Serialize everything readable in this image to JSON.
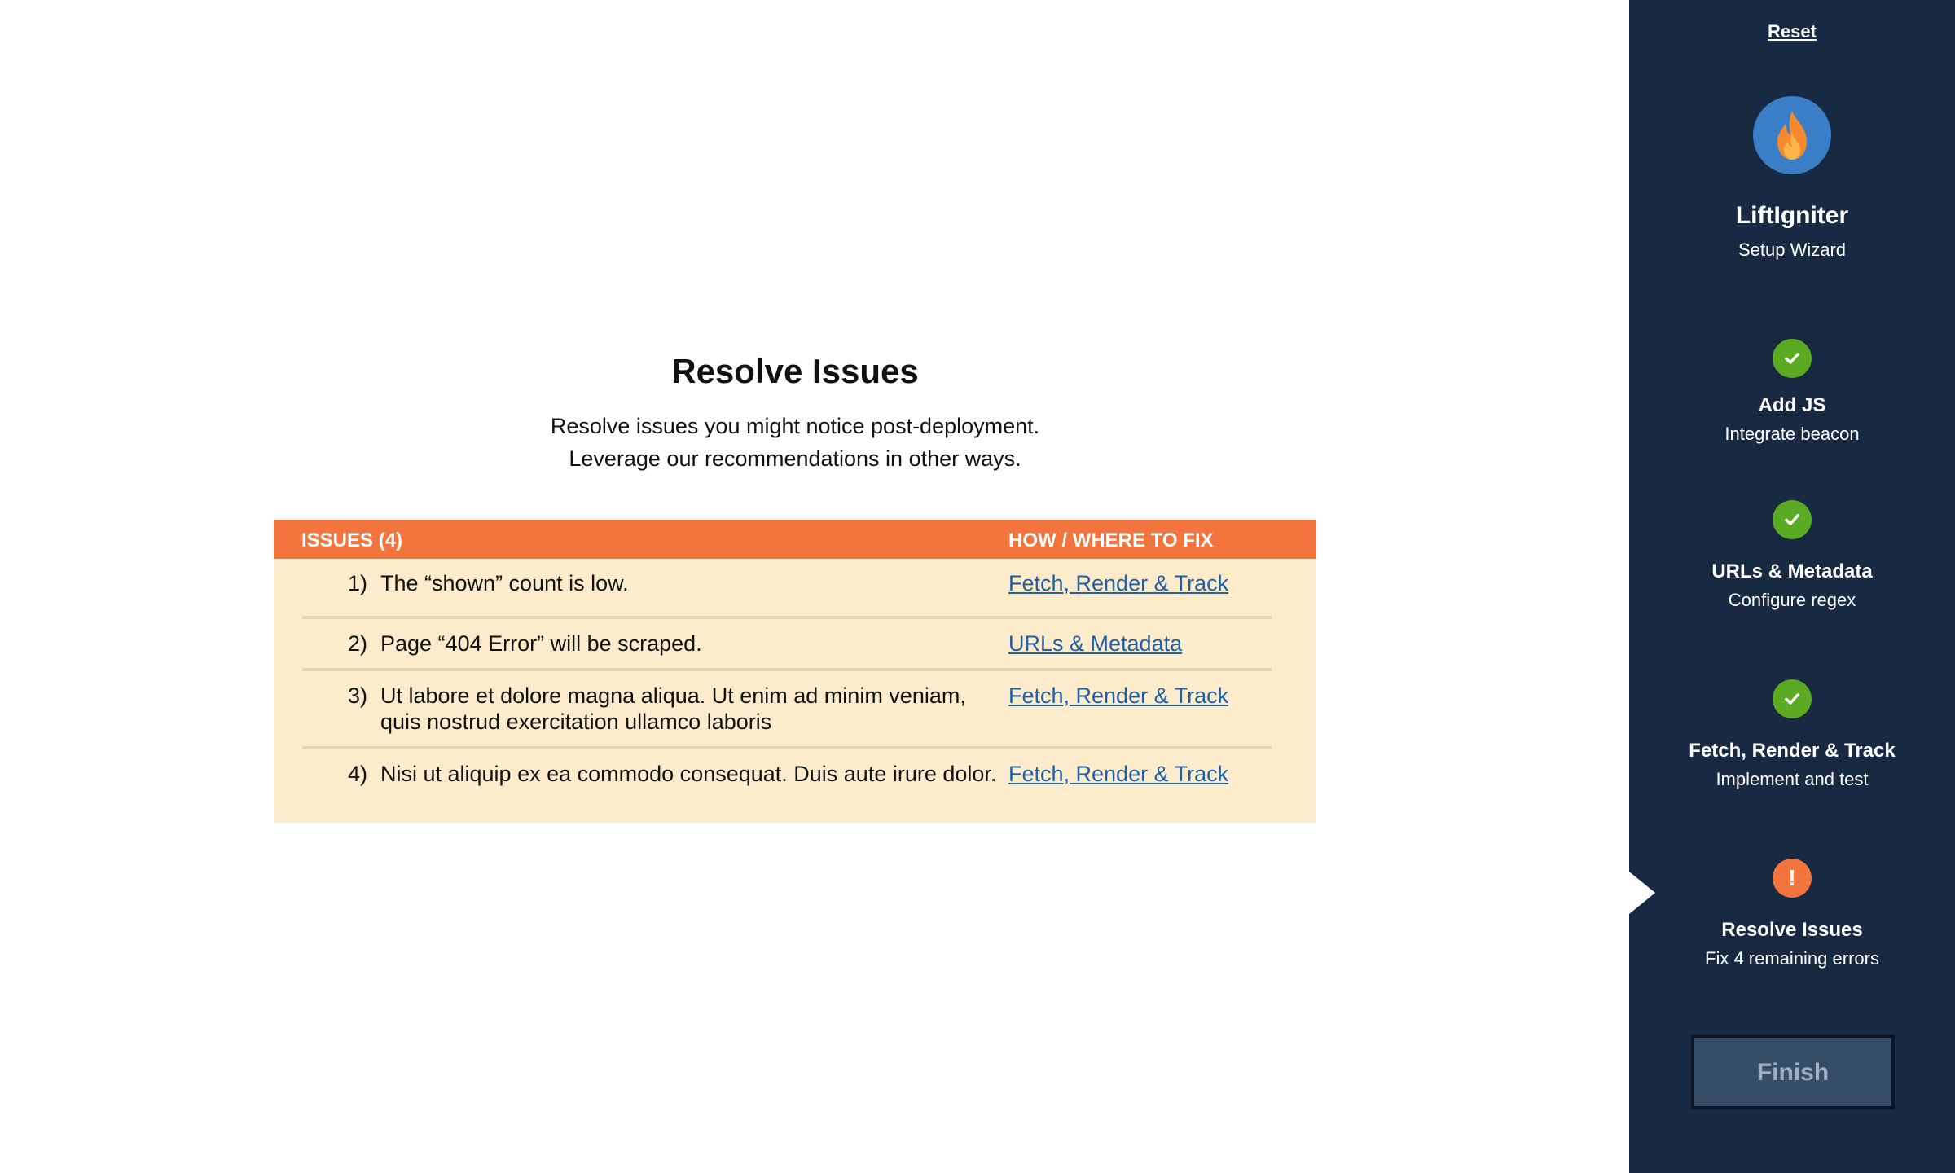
{
  "main": {
    "title": "Resolve Issues",
    "subtitle_lines": [
      "Resolve issues you might notice post-deployment.",
      "Leverage our recommendations in other ways."
    ],
    "table": {
      "header_issues": "ISSUES (4)",
      "header_fix": "HOW / WHERE TO FIX",
      "rows": [
        {
          "num": "1)",
          "text": "The “shown” count is low.",
          "fix": "Fetch, Render & Track"
        },
        {
          "num": "2)",
          "text": "Page “404 Error” will be scraped.",
          "fix": "URLs & Metadata"
        },
        {
          "num": "3)",
          "text": "Ut labore et dolore magna aliqua. Ut enim ad minim veniam, quis nostrud exercitation ullamco laboris",
          "fix": "Fetch, Render & Track"
        },
        {
          "num": "4)",
          "text": "Nisi ut aliquip ex ea commodo consequat. Duis aute irure dolor.",
          "fix": "Fetch, Render & Track"
        }
      ]
    }
  },
  "sidebar": {
    "reset_label": "Reset",
    "brand_name": "LiftIgniter",
    "brand_subtitle": "Setup Wizard",
    "logo_icon": "flame-icon",
    "steps": [
      {
        "title": "Add JS",
        "subtitle": "Integrate beacon",
        "status": "complete",
        "icon": "check-icon"
      },
      {
        "title": "URLs & Metadata",
        "subtitle": "Configure regex",
        "status": "complete",
        "icon": "check-icon"
      },
      {
        "title": "Fetch, Render & Track",
        "subtitle": "Implement and test",
        "status": "complete",
        "icon": "check-icon"
      },
      {
        "title": "Resolve Issues",
        "subtitle": "Fix 4 remaining errors",
        "status": "current-error",
        "icon": "exclamation-icon",
        "badge_text": "!"
      }
    ],
    "finish_label": "Finish"
  },
  "colors": {
    "sidebar_bg": "#172a42",
    "table_header": "#f3743c",
    "table_body": "#fdeccb",
    "link": "#1f5fa8",
    "success": "#5aab23",
    "warning": "#f3743c",
    "logo_bg": "#3b7ec8"
  }
}
